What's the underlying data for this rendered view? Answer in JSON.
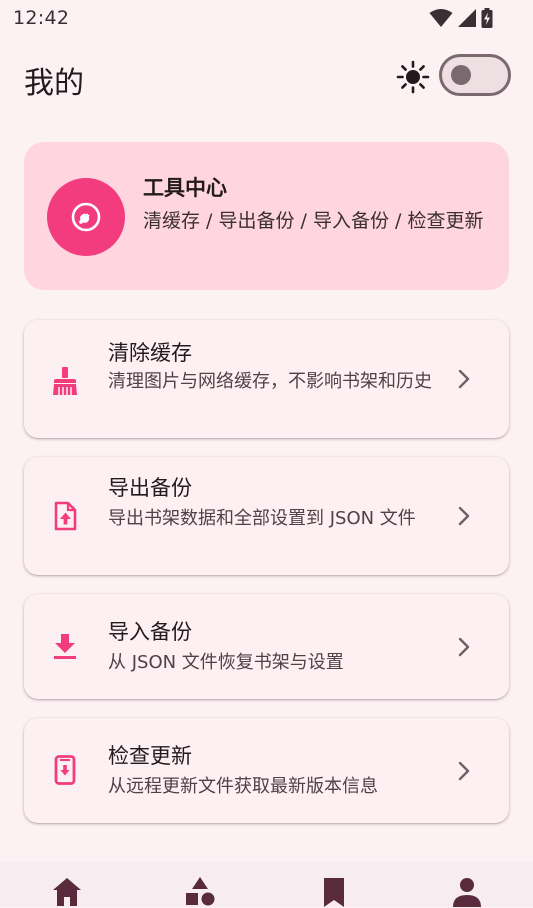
{
  "status_bar": {
    "time": "12:42"
  },
  "app_bar": {
    "title": "我的"
  },
  "tool_center": {
    "title": "工具中心",
    "description": "清缓存 / 导出备份 / 导入备份 / 检查更新"
  },
  "menu_items": [
    {
      "title": "清除缓存",
      "description": "清理图片与网络缓存，不影响书架和历史",
      "icon": "broom-icon"
    },
    {
      "title": "导出备份",
      "description": "导出书架数据和全部设置到 JSON 文件",
      "icon": "file-upload-icon"
    },
    {
      "title": "导入备份",
      "description": "从 JSON 文件恢复书架与设置",
      "icon": "download-icon"
    },
    {
      "title": "检查更新",
      "description": "从远程更新文件获取最新版本信息",
      "icon": "phone-update-icon"
    }
  ],
  "bottom_nav": [
    {
      "icon": "home-icon"
    },
    {
      "icon": "shapes-icon"
    },
    {
      "icon": "bookmark-icon"
    },
    {
      "icon": "person-icon"
    }
  ],
  "colors": {
    "accent": "#f23c7d",
    "hero_background": "#ffd6e0",
    "page_background": "#fcf2f4",
    "card_background": "#fdf0f3",
    "nav_icon": "#5a2a3d"
  }
}
